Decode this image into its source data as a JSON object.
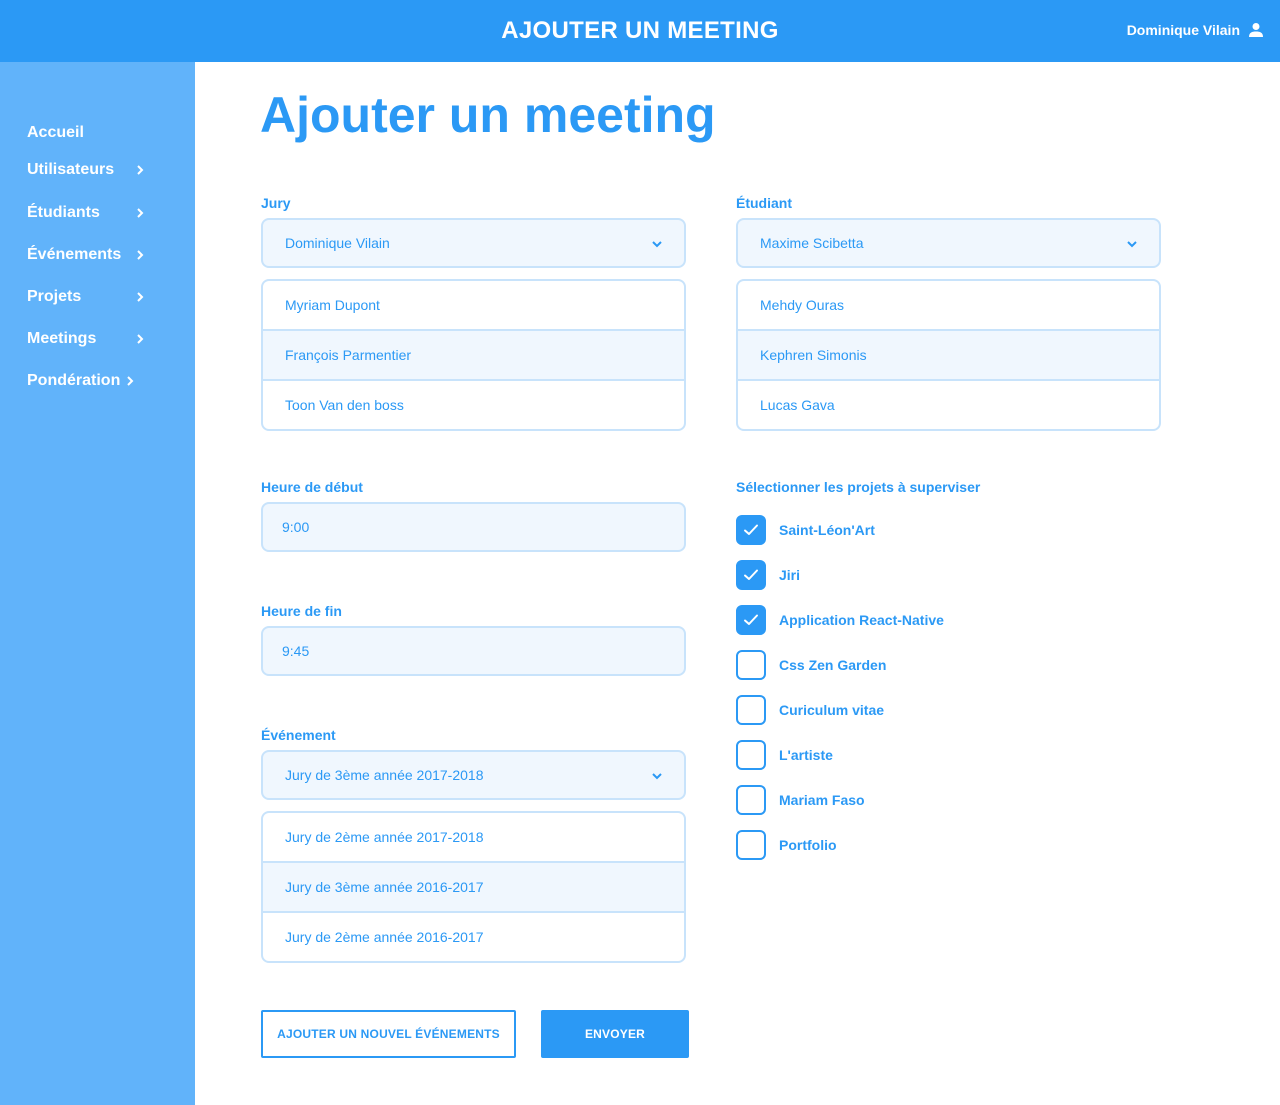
{
  "header": {
    "title": "AJOUTER UN MEETING",
    "user_name": "Dominique Vilain",
    "user_icon": "user-icon"
  },
  "sidebar": {
    "items": [
      {
        "label": "Accueil",
        "has_chevron": false
      },
      {
        "label": "Utilisateurs",
        "has_chevron": true
      },
      {
        "label": "Étudiants",
        "has_chevron": true
      },
      {
        "label": "Événements",
        "has_chevron": true
      },
      {
        "label": "Projets",
        "has_chevron": true
      },
      {
        "label": "Meetings",
        "has_chevron": true
      },
      {
        "label": "Pondération",
        "has_chevron": true
      }
    ]
  },
  "page": {
    "heading": "Ajouter un meeting"
  },
  "form": {
    "jury": {
      "label": "Jury",
      "selected": "Dominique Vilain",
      "options": [
        "Myriam Dupont",
        "François Parmentier",
        "Toon Van den boss"
      ]
    },
    "student": {
      "label": "Étudiant",
      "selected": "Maxime Scibetta",
      "options": [
        "Mehdy Ouras",
        "Kephren Simonis",
        "Lucas Gava"
      ]
    },
    "start_time": {
      "label": "Heure de début",
      "value": "9:00"
    },
    "end_time": {
      "label": "Heure de fin",
      "value": "9:45"
    },
    "event": {
      "label": "Événement",
      "selected": "Jury de 3ème année 2017-2018",
      "options": [
        "Jury de 2ème année 2017-2018",
        "Jury de 3ème année 2016-2017",
        "Jury de 2ème année 2016-2017"
      ]
    },
    "projects": {
      "label": "Sélectionner les projets à superviser",
      "items": [
        {
          "label": "Saint-Léon'Art",
          "checked": true
        },
        {
          "label": "Jiri",
          "checked": true
        },
        {
          "label": "Application React-Native",
          "checked": true
        },
        {
          "label": "Css Zen Garden",
          "checked": false
        },
        {
          "label": "Curiculum vitae",
          "checked": false
        },
        {
          "label": "L'artiste",
          "checked": false
        },
        {
          "label": "Mariam Faso",
          "checked": false
        },
        {
          "label": "Portfolio",
          "checked": false
        }
      ]
    },
    "buttons": {
      "add_event": "AJOUTER UN NOUVEL ÉVÉNEMENTS",
      "submit": "ENVOYER"
    }
  },
  "colors": {
    "primary": "#2b99f5",
    "sidebar": "#61b3fa",
    "field_bg": "#f0f7fe",
    "field_border": "#c8e3fb"
  }
}
